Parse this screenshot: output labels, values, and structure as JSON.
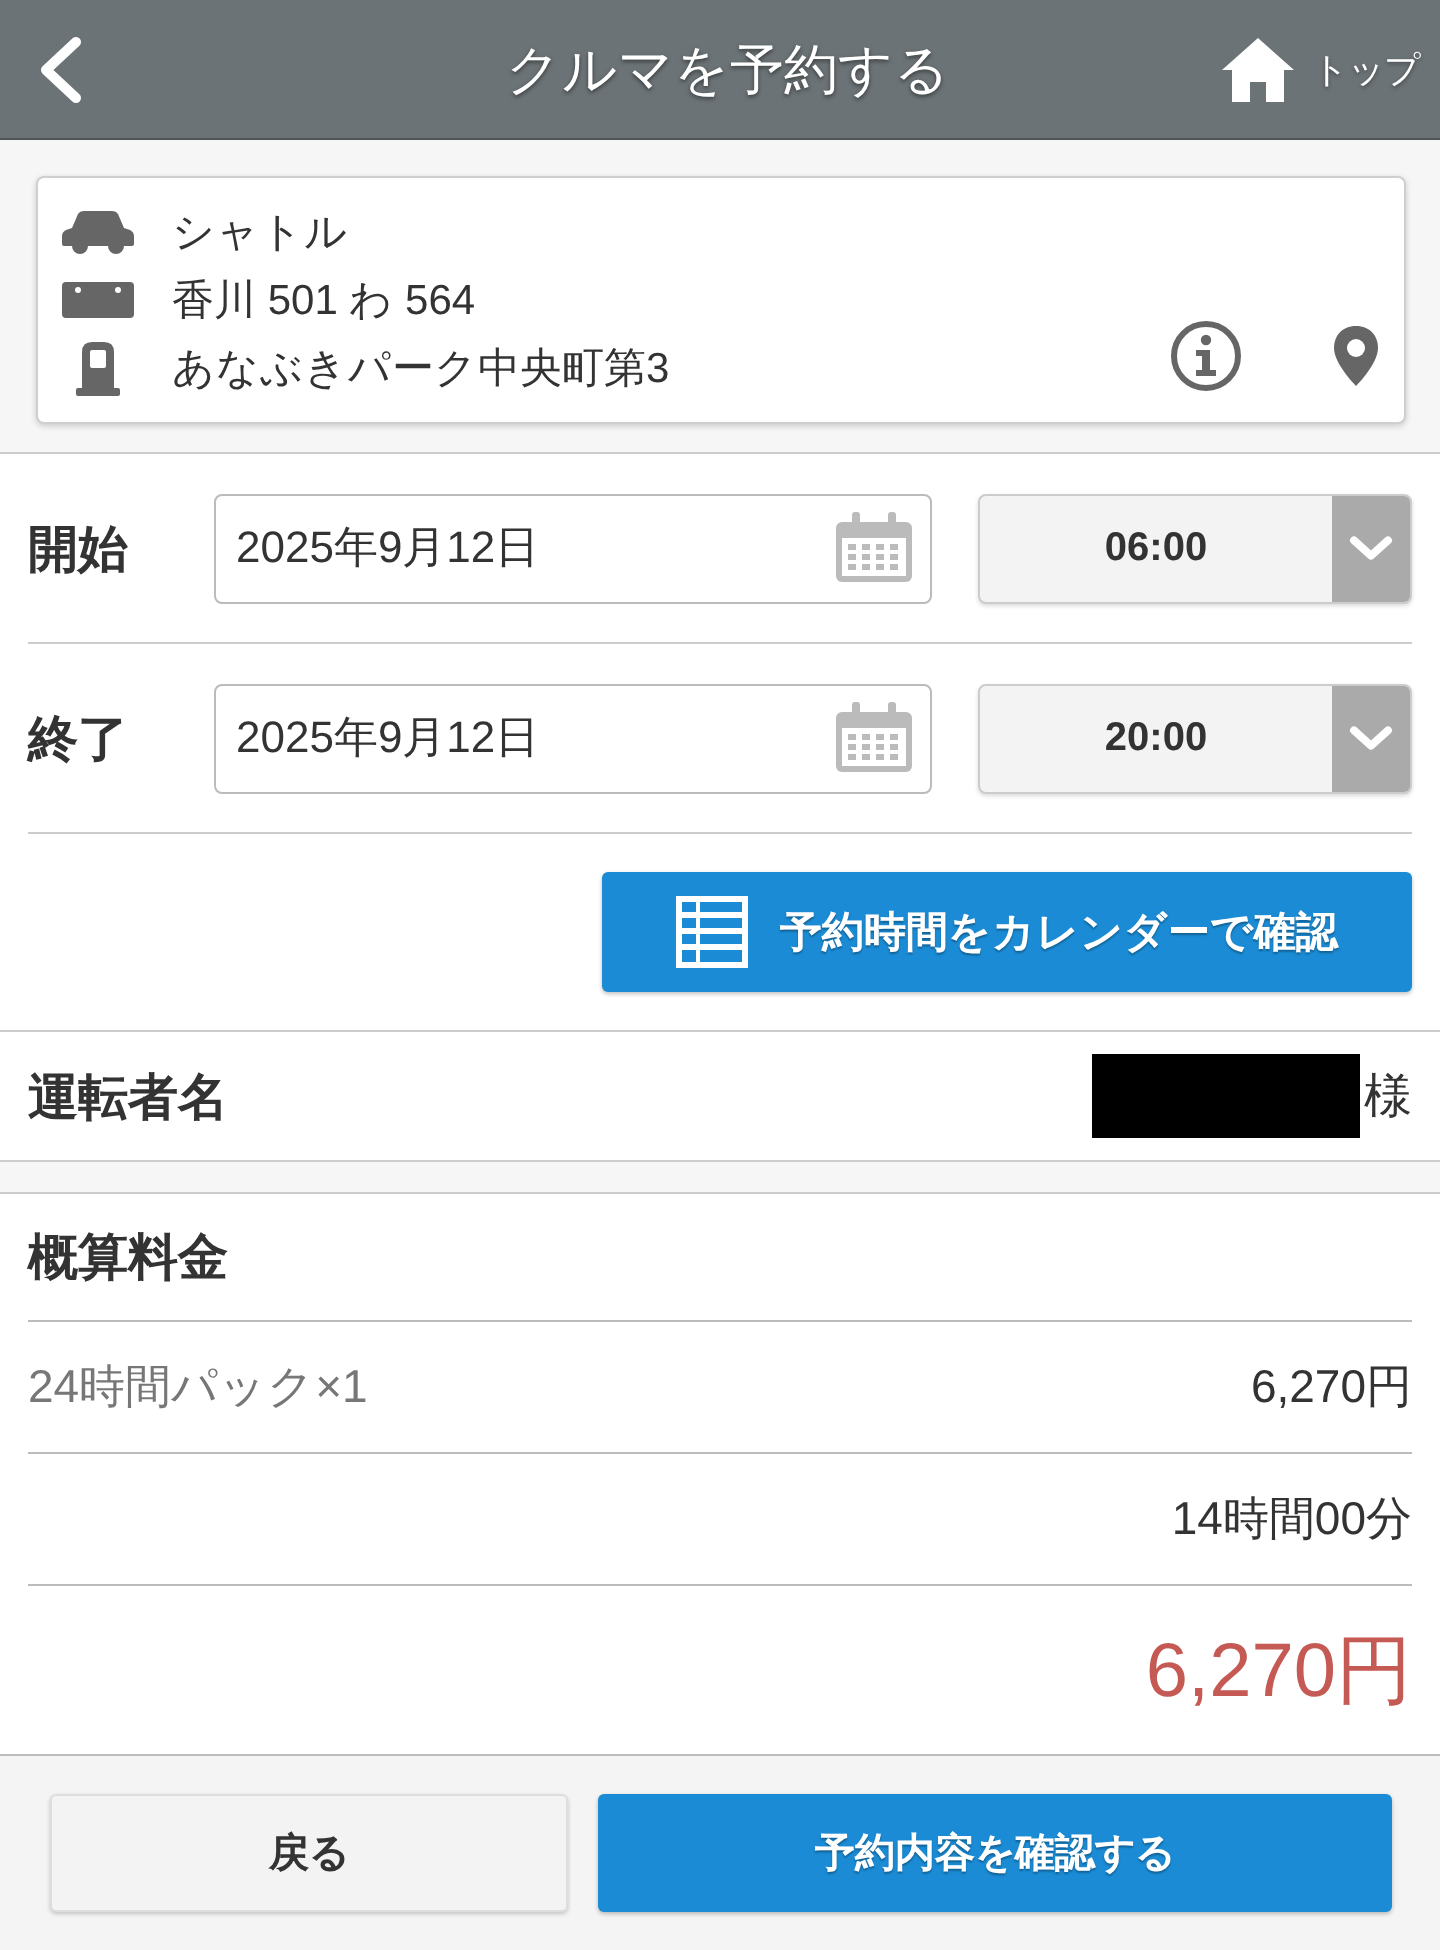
{
  "header": {
    "title": "クルマを予約する",
    "home_label": "トップ"
  },
  "vehicle": {
    "rows": [
      {
        "kind": "car",
        "text": "シャトル"
      },
      {
        "kind": "plate",
        "text": "香川 501 わ 564"
      },
      {
        "kind": "station",
        "text": "あなぶきパーク中央町第3"
      }
    ]
  },
  "schedule": [
    {
      "label": "開始",
      "date": "2025年9月12日",
      "time": "06:00"
    },
    {
      "label": "終了",
      "date": "2025年9月12日",
      "time": "20:00"
    }
  ],
  "calendar_button": "予約時間をカレンダーで確認",
  "driver": {
    "label": "運転者名",
    "name_redacted": true,
    "honorific": "様"
  },
  "fare": {
    "title": "概算料金",
    "items": [
      {
        "kind": "plan",
        "label": "24時間パック×1",
        "amount": "6,270円"
      },
      {
        "kind": "duration",
        "amount": "14時間00分"
      },
      {
        "kind": "total",
        "amount": "6,270円"
      }
    ]
  },
  "footer": {
    "buttons": [
      {
        "kind": "secondary",
        "label": "戻る"
      },
      {
        "kind": "primary",
        "label": "予約内容を確認する"
      }
    ]
  }
}
